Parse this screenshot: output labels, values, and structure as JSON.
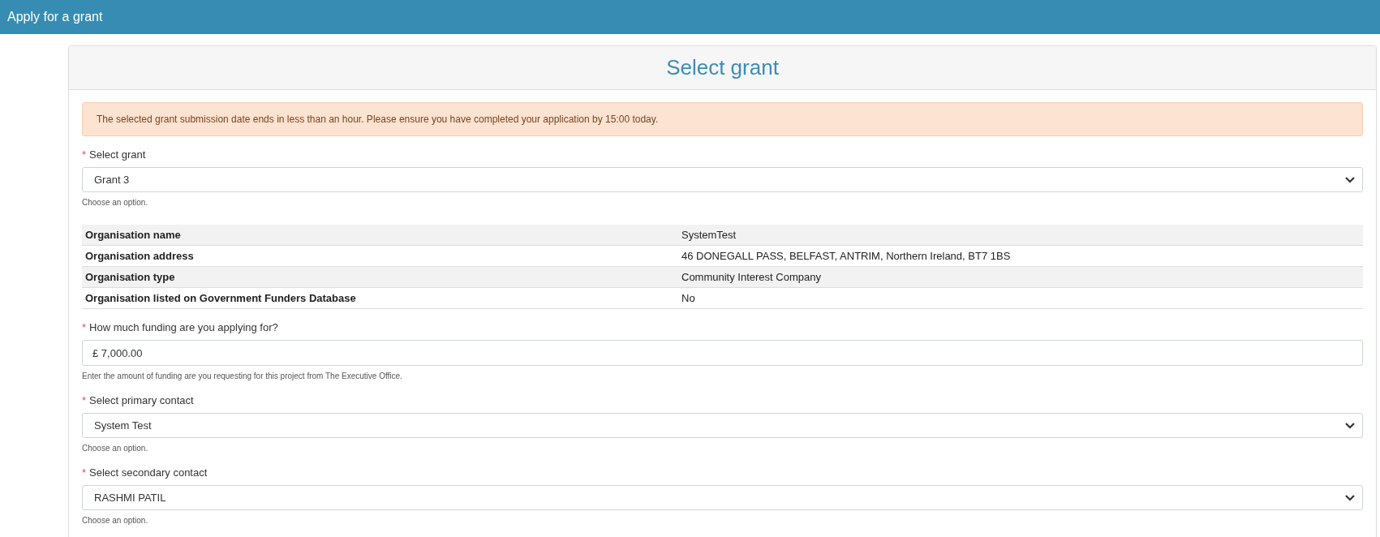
{
  "header": {
    "title": "Apply for a grant"
  },
  "card": {
    "title": "Select grant"
  },
  "alert": "The selected grant submission date ends in less than an hour. Please ensure you have completed your application by 15:00 today.",
  "fields_before": [
    {
      "kind": "select",
      "required_mark": "*",
      "label": "Select grant",
      "value": "Grant 3",
      "help": "Choose an option."
    }
  ],
  "details": [
    {
      "label": "Organisation name",
      "value": "SystemTest"
    },
    {
      "label": "Organisation address",
      "value": "46 DONEGALL PASS, BELFAST, ANTRIM, Northern Ireland, BT7 1BS"
    },
    {
      "label": "Organisation type",
      "value": "Community Interest Company"
    },
    {
      "label": "Organisation listed on Government Funders Database",
      "value": "No"
    }
  ],
  "fields_after": [
    {
      "kind": "input",
      "required_mark": "*",
      "label": "How much funding are you applying for?",
      "value": "£ 7,000.00",
      "help": "Enter the amount of funding are you requesting for this project from The Executive Office."
    },
    {
      "kind": "select",
      "required_mark": "*",
      "label": "Select primary contact",
      "value": "System Test",
      "help": "Choose an option."
    },
    {
      "kind": "select",
      "required_mark": "*",
      "label": "Select secondary contact",
      "value": "RASHMI PATIL",
      "help": "Choose an option."
    }
  ]
}
